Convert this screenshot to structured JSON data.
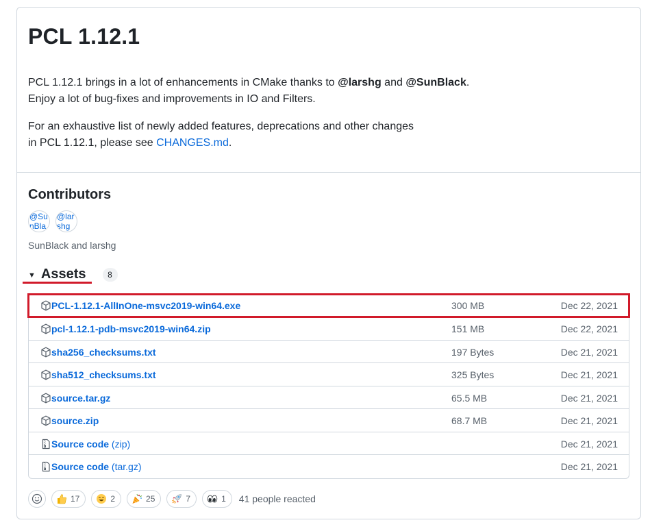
{
  "release": {
    "title": "PCL 1.12.1",
    "intro_prefix": "PCL 1.12.1 brings in a lot of enhancements in CMake thanks to ",
    "mention_1": "@larshg",
    "intro_and": " and ",
    "mention_2": "@SunBlack",
    "intro_period": ".",
    "intro_line2": "Enjoy a lot of bug-fixes and improvements in IO and Filters.",
    "changes_line1": "For an exhaustive list of newly added features, deprecations and other changes",
    "changes_prefix": "in PCL 1.12.1, please see ",
    "changes_link": "CHANGES.md",
    "changes_suffix": "."
  },
  "contributors": {
    "title": "Contributors",
    "avatars": [
      {
        "alt": "@SunBlack"
      },
      {
        "alt": "@larshg"
      }
    ],
    "names": "SunBlack and larshg"
  },
  "assets": {
    "caret": "▼",
    "title": "Assets",
    "count": "8",
    "items": [
      {
        "name": "PCL-1.12.1-AllInOne-msvc2019-win64.exe",
        "suffix": "",
        "size": "300 MB",
        "date": "Dec 22, 2021",
        "icon": "package-icon"
      },
      {
        "name": "pcl-1.12.1-pdb-msvc2019-win64.zip",
        "suffix": "",
        "size": "151 MB",
        "date": "Dec 22, 2021",
        "icon": "package-icon"
      },
      {
        "name": "sha256_checksums.txt",
        "suffix": "",
        "size": "197 Bytes",
        "date": "Dec 21, 2021",
        "icon": "package-icon"
      },
      {
        "name": "sha512_checksums.txt",
        "suffix": "",
        "size": "325 Bytes",
        "date": "Dec 21, 2021",
        "icon": "package-icon"
      },
      {
        "name": "source.tar.gz",
        "suffix": "",
        "size": "65.5 MB",
        "date": "Dec 21, 2021",
        "icon": "package-icon"
      },
      {
        "name": "source.zip",
        "suffix": "",
        "size": "68.7 MB",
        "date": "Dec 21, 2021",
        "icon": "package-icon"
      },
      {
        "name": "Source code",
        "suffix": " (zip)",
        "size": "",
        "date": "Dec 21, 2021",
        "icon": "file-zip-icon"
      },
      {
        "name": "Source code",
        "suffix": " (tar.gz)",
        "size": "",
        "date": "Dec 21, 2021",
        "icon": "file-zip-icon"
      }
    ]
  },
  "reactions": {
    "items": [
      {
        "emoji": "thumbs-up",
        "count": "17"
      },
      {
        "emoji": "smile",
        "count": "2"
      },
      {
        "emoji": "tada",
        "count": "25"
      },
      {
        "emoji": "rocket",
        "count": "7"
      },
      {
        "emoji": "eyes",
        "count": "1"
      }
    ],
    "summary": "41 people reacted"
  },
  "colors": {
    "link": "#0969da",
    "highlight": "#d11a2a",
    "border": "#d0d7de",
    "muted": "#57606a"
  }
}
